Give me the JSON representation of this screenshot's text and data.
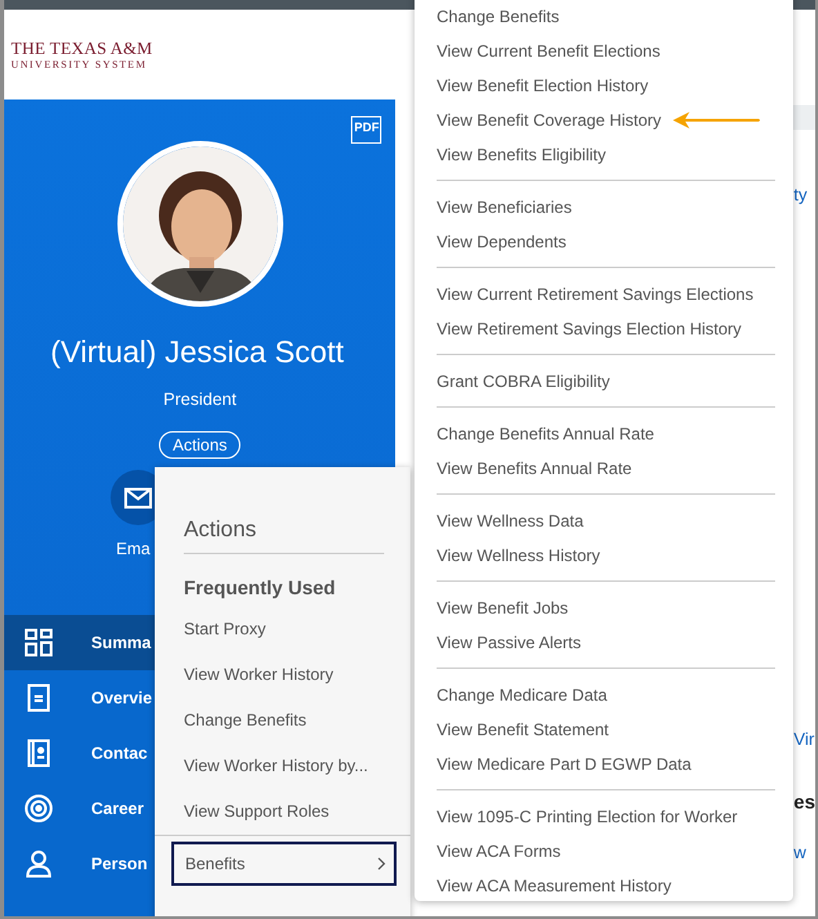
{
  "logo": {
    "line_1": "THE TEXAS A&M",
    "line_2": "UNIVERSITY SYSTEM"
  },
  "profile": {
    "pdf_label": "PDF",
    "name": "(Virtual) Jessica Scott",
    "title": "President",
    "actions_button": "Actions",
    "quick_actions": [
      {
        "label": "Ema",
        "kind": "email"
      }
    ]
  },
  "sidebar": {
    "items": [
      {
        "label": "Summa",
        "kind": "grid",
        "selected": true
      },
      {
        "label": "Overvie",
        "kind": "document",
        "selected": false
      },
      {
        "label": "Contac",
        "kind": "contact",
        "selected": false
      },
      {
        "label": "Career",
        "kind": "target",
        "selected": false
      },
      {
        "label": "Person",
        "kind": "person",
        "selected": false
      }
    ]
  },
  "actions_menu": {
    "title": "Actions",
    "section": "Frequently Used",
    "items": [
      "Start Proxy",
      "View Worker History",
      "Change Benefits",
      "View Worker History by...",
      "View Support Roles"
    ],
    "categories": [
      {
        "label": "Benefits",
        "focused": true
      }
    ]
  },
  "benefits_submenu": {
    "groups": [
      [
        {
          "label": "Change Benefits",
          "marked": false
        },
        {
          "label": "View Current Benefit Elections",
          "marked": false
        },
        {
          "label": "View Benefit Election History",
          "marked": false
        },
        {
          "label": "View Benefit Coverage History",
          "marked": true
        },
        {
          "label": "View Benefits Eligibility",
          "marked": false
        }
      ],
      [
        {
          "label": "View Beneficiaries",
          "marked": false
        },
        {
          "label": "View Dependents",
          "marked": false
        }
      ],
      [
        {
          "label": "View Current Retirement Savings Elections",
          "marked": false
        },
        {
          "label": "View Retirement Savings Election History",
          "marked": false
        }
      ],
      [
        {
          "label": "Grant COBRA Eligibility",
          "marked": false
        }
      ],
      [
        {
          "label": "Change Benefits Annual Rate",
          "marked": false
        },
        {
          "label": "View Benefits Annual Rate",
          "marked": false
        }
      ],
      [
        {
          "label": "View Wellness Data",
          "marked": false
        },
        {
          "label": "View Wellness History",
          "marked": false
        }
      ],
      [
        {
          "label": "View Benefit Jobs",
          "marked": false
        },
        {
          "label": "View Passive Alerts",
          "marked": false
        }
      ],
      [
        {
          "label": "Change Medicare Data",
          "marked": false
        },
        {
          "label": "View Benefit Statement",
          "marked": false
        },
        {
          "label": "View Medicare Part D EGWP Data",
          "marked": false
        }
      ],
      [
        {
          "label": "View 1095-C Printing Election for Worker",
          "marked": false
        },
        {
          "label": "View ACA Forms",
          "marked": false
        },
        {
          "label": "View ACA Measurement History",
          "marked": false
        }
      ]
    ]
  },
  "background_fragments": [
    {
      "text": "ty",
      "kind": "link"
    },
    {
      "text": "Vir",
      "kind": "link"
    },
    {
      "text": "es",
      "kind": "heading"
    },
    {
      "text": "w",
      "kind": "link"
    }
  ]
}
